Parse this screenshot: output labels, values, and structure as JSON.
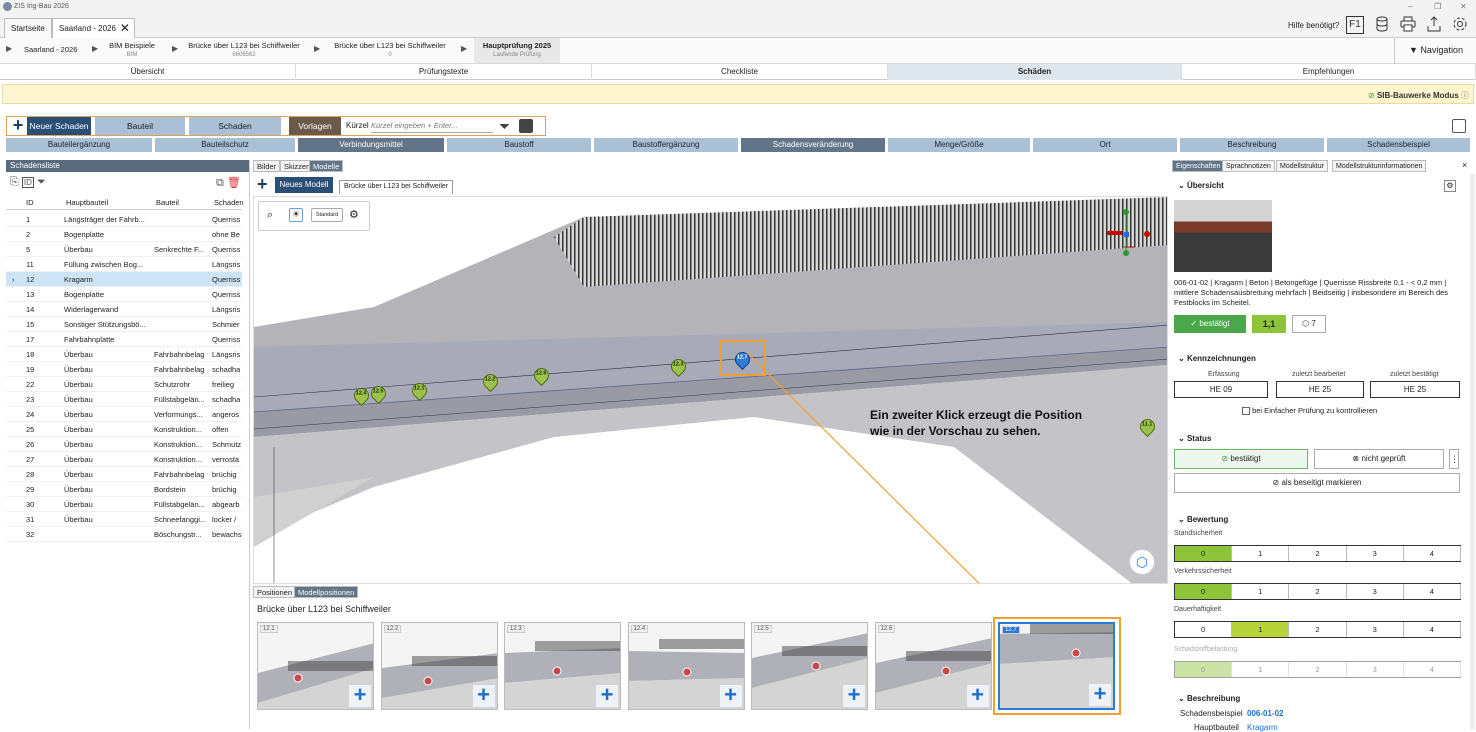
{
  "app": {
    "title": "ZIS Ing-Bau 2026"
  },
  "window_controls": {
    "minimize": "–",
    "restore": "❐",
    "close": "✕"
  },
  "doc_tabs": [
    {
      "label": "Startseite"
    },
    {
      "label": "Saarland - 2026"
    }
  ],
  "help_text": "Hilfe benötigt?",
  "toolbar_icons": {
    "f1": "F1",
    "db": "database-icon",
    "print": "printer-icon",
    "export": "export-icon",
    "settings": "gear-icon"
  },
  "breadcrumb": [
    {
      "label": "Saarland - 2026",
      "sub": ""
    },
    {
      "label": "BIM Beispiele",
      "sub": "BIM"
    },
    {
      "label": "Brücke über L123 bei Schiffweiler",
      "sub": "6606562"
    },
    {
      "label": "Brücke über L123 bei Schiffweiler",
      "sub": "0"
    },
    {
      "label": "Hauptprüfung 2025",
      "sub": "Laufende Prüfung"
    }
  ],
  "navigation_label": "Navigation",
  "main_tabs": [
    "Übersicht",
    "Prüfungstexte",
    "Checkliste",
    "Schäden",
    "Empfehlungen"
  ],
  "active_main_tab": "Schäden",
  "sib_mode": "SIB-Bauwerke Modus",
  "toolbar": {
    "new_damage": "Neuer Schaden",
    "component": "Bauteil",
    "damage": "Schaden",
    "templates": "Vorlagen",
    "shortcut_label": "Kürzel",
    "shortcut_placeholder": "Kürzel eingeben + Enter..."
  },
  "categories": [
    {
      "label": "Bauteilergänzung",
      "style": "light"
    },
    {
      "label": "Bauteilschutz",
      "style": "light"
    },
    {
      "label": "Verbindungsmittel",
      "style": "dark"
    },
    {
      "label": "Baustoff",
      "style": "light"
    },
    {
      "label": "Baustoffergänzung",
      "style": "light"
    },
    {
      "label": "Schadensveränderung",
      "style": "dark"
    },
    {
      "label": "Menge/Größe",
      "style": "light"
    },
    {
      "label": "Ort",
      "style": "light"
    },
    {
      "label": "Beschreibung",
      "style": "light"
    },
    {
      "label": "Schadensbeispiel",
      "style": "light"
    }
  ],
  "damage_list": {
    "title": "Schadensliste",
    "columns": [
      "ID",
      "Hauptbauteil",
      "Bauteil",
      "Schaden"
    ],
    "rows": [
      {
        "id": "1",
        "main": "Längsträger der Fahrb...",
        "part": "",
        "damage": "Querriss"
      },
      {
        "id": "2",
        "main": "Bogenplatte",
        "part": "",
        "damage": "ohne Be"
      },
      {
        "id": "5",
        "main": "Überbau",
        "part": "Senkrechte F...",
        "damage": "Querriss"
      },
      {
        "id": "11",
        "main": "Füllung zwischen Bog...",
        "part": "",
        "damage": "Längsris"
      },
      {
        "id": "12",
        "main": "Kragarm",
        "part": "",
        "damage": "Querriss"
      },
      {
        "id": "13",
        "main": "Bogenplatte",
        "part": "",
        "damage": "Querriss"
      },
      {
        "id": "14",
        "main": "Widerlagerwand",
        "part": "",
        "damage": "Längsris"
      },
      {
        "id": "15",
        "main": "Sonstiger Stützungsbö...",
        "part": "",
        "damage": "Schmier"
      },
      {
        "id": "17",
        "main": "Fahrbahnplatte",
        "part": "",
        "damage": "Querriss"
      },
      {
        "id": "18",
        "main": "Überbau",
        "part": "Fahrbahnbelag",
        "damage": "Längsris"
      },
      {
        "id": "19",
        "main": "Überbau",
        "part": "Fahrbahnbelag",
        "damage": "schadha"
      },
      {
        "id": "22",
        "main": "Überbau",
        "part": "Schutzrohr",
        "damage": "freilieg"
      },
      {
        "id": "23",
        "main": "Überbau",
        "part": "Füllstabgelän...",
        "damage": "schadha"
      },
      {
        "id": "24",
        "main": "Überbau",
        "part": "Verformungs...",
        "damage": "angeros"
      },
      {
        "id": "25",
        "main": "Überbau",
        "part": "Konstruktion...",
        "damage": "offen"
      },
      {
        "id": "26",
        "main": "Überbau",
        "part": "Konstruktion...",
        "damage": "Schmutz"
      },
      {
        "id": "27",
        "main": "Überbau",
        "part": "Konstruktion...",
        "damage": "verrosta"
      },
      {
        "id": "28",
        "main": "Überbau",
        "part": "Fahrbahnbelag",
        "damage": "brüchig"
      },
      {
        "id": "29",
        "main": "Überbau",
        "part": "Bordstein",
        "damage": "brüchig"
      },
      {
        "id": "30",
        "main": "Überbau",
        "part": "Füllstabgelän...",
        "damage": "abgearb"
      },
      {
        "id": "31",
        "main": "Überbau",
        "part": "Schneefanggi...",
        "damage": "locker /"
      },
      {
        "id": "32",
        "main": "",
        "part": "Böschungstr...",
        "damage": "bewachs"
      }
    ],
    "selected_id": "12"
  },
  "viewer": {
    "tabs": [
      "Bilder",
      "Skizzen",
      "Modelle"
    ],
    "active_tab": "Modelle",
    "new_model": "Neues Modell",
    "model_tab": "Brücke über L123 bei Schiffweiler",
    "standard_label": "Standard",
    "pins": [
      "12.4",
      "12.5",
      "12.1",
      "12.2",
      "12.6",
      "12.3",
      "12.7",
      "11.1"
    ],
    "active_pin": "12.7",
    "annotation": "Ein zweiter Klick erzeugt die Position wie in der Vorschau zu sehen."
  },
  "positions": {
    "tabs": [
      "Positionen",
      "Modellpositionen"
    ],
    "active_tab": "Modellpositionen",
    "title": "Brücke über L123 bei Schiffweiler",
    "thumbs": [
      "12.1",
      "12.2",
      "12.3",
      "12.4",
      "12.5",
      "12.6",
      "12.7"
    ],
    "add_label": "+"
  },
  "right_panel": {
    "tabs": [
      "Eigenschaften",
      "Sprachnotizen",
      "Modellstruktur",
      "Modellstrukturinformationen"
    ],
    "active_tab": "Eigenschaften",
    "overview_title": "Übersicht",
    "description": "006-01-02 | Kragarm | Beton | Betongefüge | Querrisse Rissbreite 0,1 - < 0,2 mm | mittlere Schadensausbreitung mehrfach | Beidseitig | insbesondere im Bereich des Festblocks im Scheitel.",
    "confirmed_label": "bestätigt",
    "rating_value": "1,1",
    "model_count": "7",
    "marks_title": "Kennzeichnungen",
    "marks": [
      {
        "label": "Erfassung",
        "value": "HE 09"
      },
      {
        "label": "zuletzt bearbeitet",
        "value": "HE 25"
      },
      {
        "label": "zuletzt bestätigt",
        "value": "HE 25"
      }
    ],
    "simple_check": "bei Einfacher Prüfung zu kontrollieren",
    "status_title": "Status",
    "status_confirmed": "bestätigt",
    "status_not_checked": "nicht geprüft",
    "mark_removed": "als beseitigt markieren",
    "assessment_title": "Bewertung",
    "assessments": [
      {
        "label": "Standsicherheit",
        "selected": 0
      },
      {
        "label": "Verkehrssicherheit",
        "selected": 0
      },
      {
        "label": "Dauerhaftigkeit",
        "selected": 1
      },
      {
        "label": "Schadstoffbelastung",
        "selected": 0
      }
    ],
    "scale": [
      "0",
      "1",
      "2",
      "3",
      "4"
    ],
    "description_title": "Beschreibung",
    "example_label": "Schadensbeispiel",
    "example_value": "006-01-02",
    "main_part_label": "Hauptbauteil",
    "main_part_value": "Kragarm"
  },
  "colors": {
    "accent": "#1a6fd0",
    "header": "#5a6b7d",
    "green": "#5cb85c",
    "lime": "#b7d33a",
    "orange": "#f0a030"
  }
}
